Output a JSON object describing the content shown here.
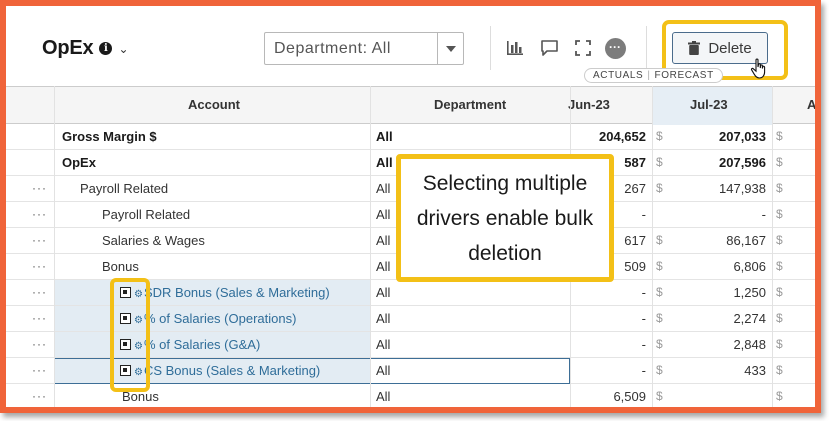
{
  "toolbar": {
    "title": "OpEx",
    "department_filter": "Department: All",
    "delete_label": "Delete",
    "view_toggle": {
      "actuals": "ACTUALS",
      "forecast": "FORECAST"
    }
  },
  "icons": {
    "info": "info-icon",
    "chart": "bar-chart-icon",
    "comment": "comment-icon",
    "expand": "expand-icon",
    "more": "more-icon",
    "trash": "trash-icon",
    "cursor": "hand-pointer-icon"
  },
  "grid": {
    "headers": {
      "account": "Account",
      "department": "Department",
      "jun": "Jun-23",
      "jul": "Jul-23",
      "aug": "A"
    },
    "rows": [
      {
        "menu": "",
        "account": "Gross Margin $",
        "department": "All",
        "jun": "204,652",
        "jul_currency": "$",
        "jul": "207,033",
        "aug_currency": "$"
      },
      {
        "menu": "",
        "account": "OpEx",
        "department": "All",
        "jun": "587",
        "jul_currency": "$",
        "jul": "207,596",
        "aug_currency": "$"
      },
      {
        "menu": "···",
        "account": "Payroll Related",
        "department": "All",
        "jun": "267",
        "jul_currency": "$",
        "jul": "147,938",
        "aug_currency": "$"
      },
      {
        "menu": "···",
        "account": "Payroll Related",
        "department": "All",
        "jun": "-",
        "jul_currency": "",
        "jul": "-",
        "aug_currency": "$"
      },
      {
        "menu": "···",
        "account": "Salaries & Wages",
        "department": "All",
        "jun": "617",
        "jul_currency": "$",
        "jul": "86,167",
        "aug_currency": "$"
      },
      {
        "menu": "···",
        "account": "Bonus",
        "department": "All",
        "jun": "509",
        "jul_currency": "$",
        "jul": "6,806",
        "aug_currency": "$"
      },
      {
        "menu": "···",
        "account": "SDR Bonus (Sales & Marketing)",
        "department": "All",
        "jun": "-",
        "jul_currency": "$",
        "jul": "1,250",
        "aug_currency": "$"
      },
      {
        "menu": "···",
        "account": "% of Salaries (Operations)",
        "department": "All",
        "jun": "-",
        "jul_currency": "$",
        "jul": "2,274",
        "aug_currency": "$"
      },
      {
        "menu": "···",
        "account": "% of Salaries (G&A)",
        "department": "All",
        "jun": "-",
        "jul_currency": "$",
        "jul": "2,848",
        "aug_currency": "$"
      },
      {
        "menu": "···",
        "account": "CS Bonus (Sales & Marketing)",
        "department": "All",
        "jun": "-",
        "jul_currency": "$",
        "jul": "433",
        "aug_currency": "$"
      },
      {
        "menu": "···",
        "account": "Bonus",
        "department": "All",
        "jun": "6,509",
        "jul_currency": "$",
        "jul": "",
        "aug_currency": "$"
      }
    ]
  },
  "callout": {
    "line1": "Selecting multiple",
    "line2": "drivers enable bulk",
    "line3": "deletion"
  },
  "colors": {
    "frame": "#f0643a",
    "highlight": "#f3c017",
    "link": "#2f6d99",
    "selected_row": "#e3ecf3"
  }
}
